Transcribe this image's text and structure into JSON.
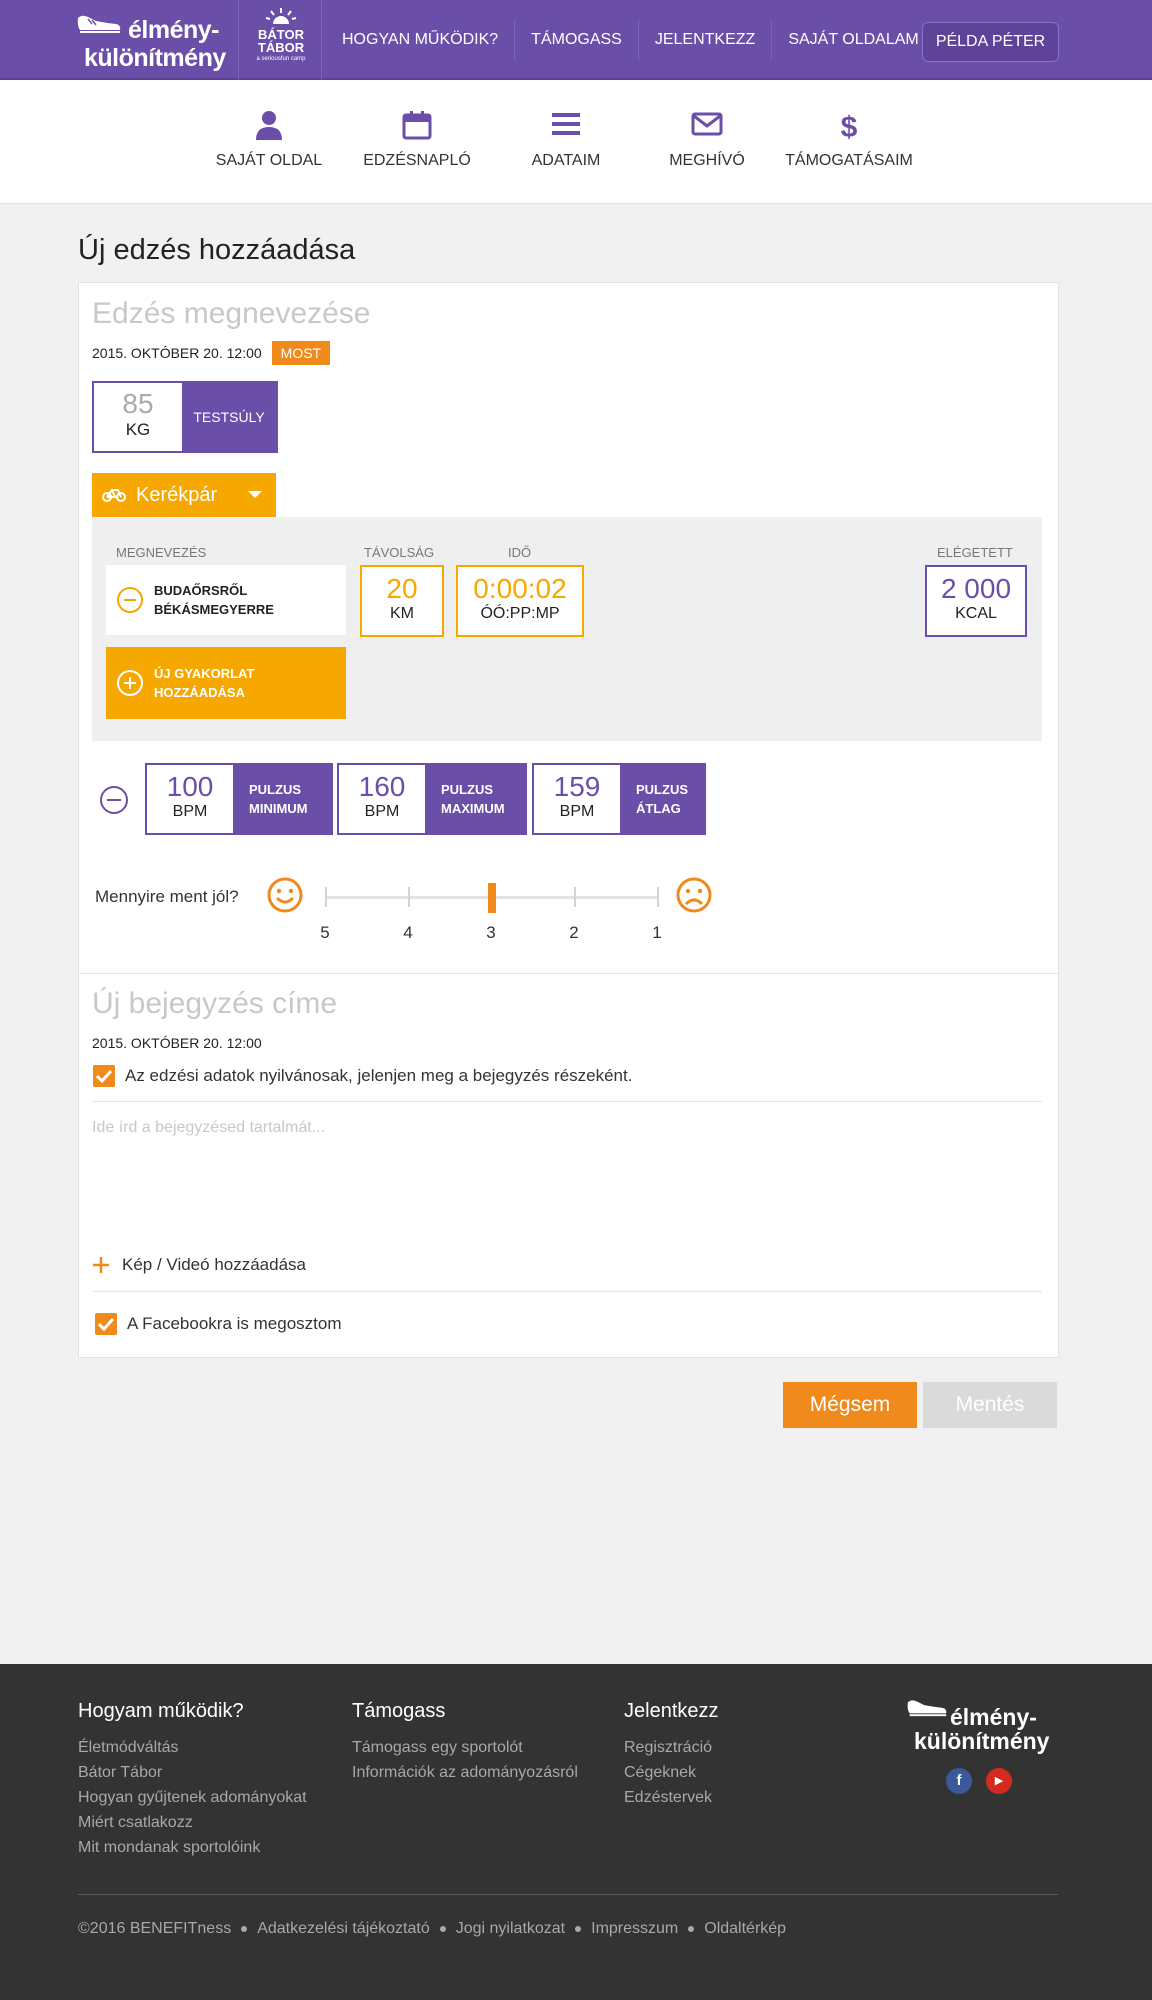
{
  "brand": {
    "line1": "élmény-",
    "line2": "különítmény"
  },
  "partner": {
    "line1": "BÁTOR",
    "line2": "TÁBOR",
    "line3": "a seriousfun camp"
  },
  "nav": {
    "items": [
      "HOGYAN MŰKÖDIK?",
      "TÁMOGASS",
      "JELENTKEZZ",
      "SAJÁT OLDALAM"
    ],
    "user": "PÉLDA PÉTER"
  },
  "subnav": [
    {
      "label": "SAJÁT OLDAL",
      "icon": "user-icon"
    },
    {
      "label": "EDZÉSNAPLÓ",
      "icon": "calendar-icon"
    },
    {
      "label": "ADATAIM",
      "icon": "list-icon"
    },
    {
      "label": "MEGHÍVÓ",
      "icon": "envelope-icon"
    },
    {
      "label": "TÁMOGATÁSAIM",
      "icon": "dollar-icon"
    }
  ],
  "page_title": "Új edzés hozzáadása",
  "workout": {
    "name_placeholder": "Edzés megnevezése",
    "date": "2015. OKTÓBER 20. 12:00",
    "now_label": "MOST",
    "bodyweight": {
      "value": "85",
      "unit": "KG",
      "label": "TESTSÚLY"
    },
    "sport": "Kerékpár",
    "columns": {
      "name": "MEGNEVEZÉS",
      "distance": "TÁVOLSÁG",
      "time": "IDŐ",
      "burned": "ELÉGETETT"
    },
    "exercise": {
      "line1": "BUDAŐRSRŐL",
      "line2": "BÉKÁSMEGYERRE",
      "distance": "20",
      "distance_unit": "KM",
      "time": "0:00:02",
      "time_unit": "ÓÓ:PP:MP",
      "kcal": "2 000",
      "kcal_unit": "KCAL"
    },
    "add_exercise": {
      "line1": "ÚJ GYAKORLAT",
      "line2": "HOZZÁADÁSA"
    },
    "pulse": [
      {
        "value": "100",
        "unit": "BPM",
        "l1": "PULZUS",
        "l2": "MINIMUM"
      },
      {
        "value": "160",
        "unit": "BPM",
        "l1": "PULZUS",
        "l2": "MAXIMUM"
      },
      {
        "value": "159",
        "unit": "BPM",
        "l1": "PULZUS",
        "l2": "ÁTLAG"
      }
    ],
    "rating": {
      "label": "Mennyire ment jól?",
      "ticks": [
        "5",
        "4",
        "3",
        "2",
        "1"
      ],
      "selected": "3"
    }
  },
  "entry": {
    "title_placeholder": "Új bejegyzés címe",
    "date": "2015. OKTÓBER 20. 12:00",
    "public_label": "Az edzési adatok nyilvánosak, jelenjen meg a bejegyzés részeként.",
    "content_placeholder": "Ide írd a bejegyzésed tartalmát...",
    "media_label": "Kép / Videó hozzáadása",
    "facebook_label": "A Facebookra is megosztom"
  },
  "buttons": {
    "cancel": "Mégsem",
    "save": "Mentés"
  },
  "colors": {
    "purple": "#6b4ea8",
    "orange": "#f08a1c",
    "yellow": "#f7a800"
  },
  "footer": {
    "col1": {
      "title": "Hogyam működik?",
      "links": [
        "Életmódváltás",
        "Bátor Tábor",
        "Hogyan gyűjtenek adományokat",
        "Miért csatlakozz",
        "Mit mondanak sportolóink"
      ]
    },
    "col2": {
      "title": "Támogass",
      "links": [
        "Támogass egy sportolót",
        "Információk az adományozásról"
      ]
    },
    "col3": {
      "title": "Jelentkezz",
      "links": [
        "Regisztráció",
        "Cégeknek",
        "Edzéstervek"
      ]
    },
    "bottom": [
      "©2016 BENEFITness",
      "Adatkezelési tájékoztató",
      "Jogi nyilatkozat",
      "Impresszum",
      "Oldaltérkép"
    ]
  }
}
